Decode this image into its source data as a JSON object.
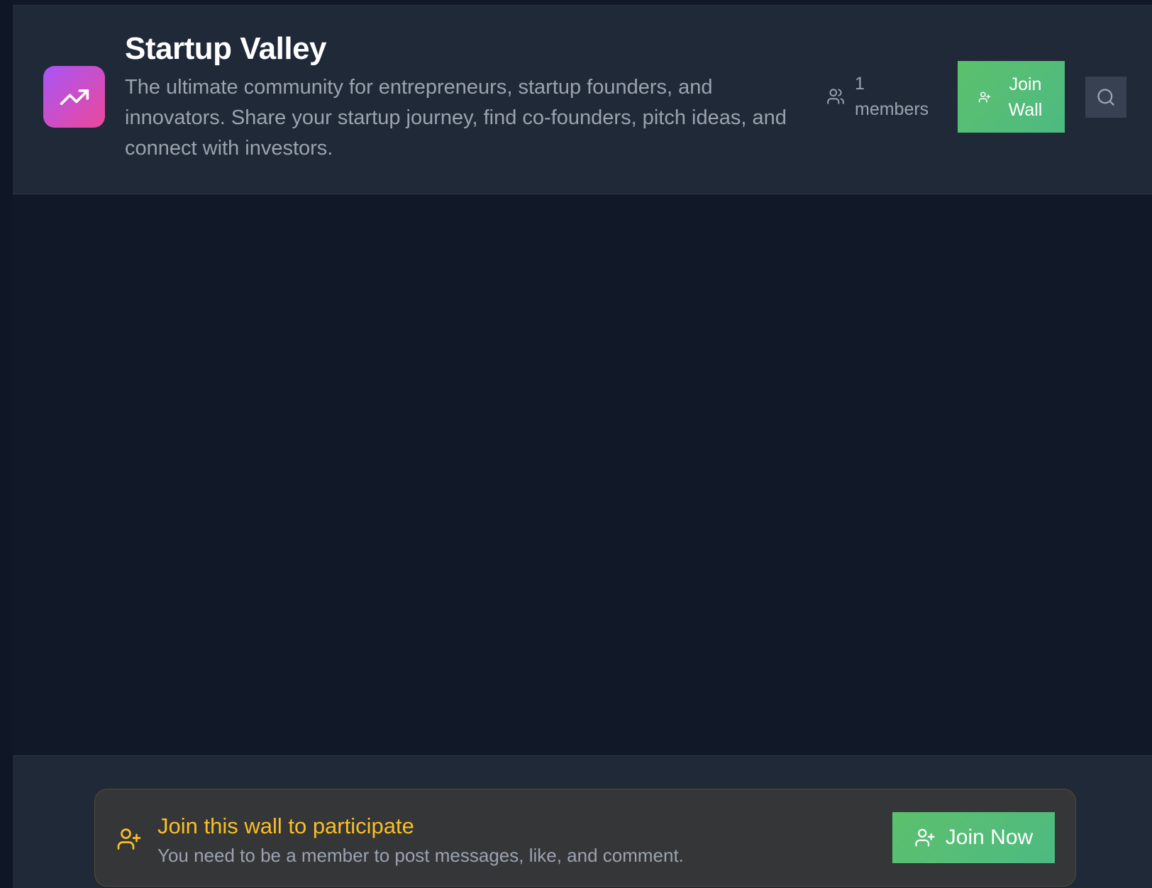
{
  "wall": {
    "title": "Startup Valley",
    "description": "The ultimate community for entrepreneurs, startup founders, and innovators. Share your startup journey, find co-founders, pitch ideas, and connect with investors.",
    "logo_icon": "trending-up-icon",
    "members_text": "1 members",
    "join_label": "Join Wall",
    "search_icon": "search-icon"
  },
  "join_notice": {
    "title": "Join this wall to participate",
    "subtitle": "You need to be a member to post messages, like, and comment.",
    "button_label": "Join Now",
    "icon": "user-plus-icon"
  },
  "colors": {
    "page_background": "#111827",
    "header_background": "#1f2937",
    "accent_green": "#5cc06c",
    "logo_gradient_start": "#a855f7",
    "logo_gradient_end": "#ec4899",
    "notice_title": "#fbbf24",
    "muted_text": "#9ca3af"
  }
}
